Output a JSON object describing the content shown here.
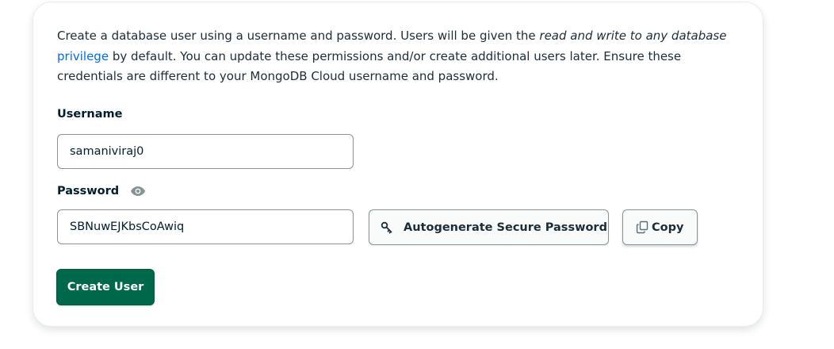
{
  "intro": {
    "text_1": "Create a database user using a username and password. Users will be given the ",
    "emphasis": "read and write to any database",
    "link": "privilege",
    "text_2": " by default. You can update these permissions and/or create additional users later. Ensure these credentials are different to your MongoDB Cloud username and password."
  },
  "username": {
    "label": "Username",
    "value": "samaniviraj0"
  },
  "password": {
    "label": "Password",
    "value": "SBNuwEJKbsCoAwiq",
    "visibility_icon": "eye-icon"
  },
  "buttons": {
    "autogenerate_label": "Autogenerate Secure Password",
    "autogenerate_icon": "key-icon",
    "copy_label": "Copy",
    "copy_icon": "copy-icon",
    "create_label": "Create User"
  },
  "colors": {
    "primary_green": "#00684a",
    "link_blue": "#016bf8",
    "text_dark": "#1c2d38"
  }
}
